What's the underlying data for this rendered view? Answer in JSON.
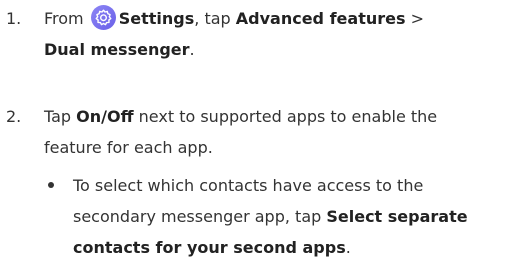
{
  "steps": [
    {
      "number": "1.",
      "from_text": "From ",
      "settings_label": "Settings",
      "tap_text": ", tap ",
      "advanced_label": "Advanced features",
      "chevron": " >",
      "dual_label": "Dual messenger",
      "period": "."
    },
    {
      "number": "2.",
      "tap_text": "Tap ",
      "onoff_label": "On/Off",
      "line1_rest": " next to supported apps to enable the",
      "line2": "feature for each app."
    }
  ],
  "bullet": {
    "line1": "To select which contacts have access to the",
    "line2_text": "secondary messenger app, tap ",
    "line2_bold": "Select separate",
    "line3_bold": "contacts for your second apps",
    "line3_end": "."
  },
  "colors": {
    "settings_icon_bg": "#7b73f0",
    "text": "#333333"
  },
  "icons": {
    "settings": "gear-icon"
  }
}
